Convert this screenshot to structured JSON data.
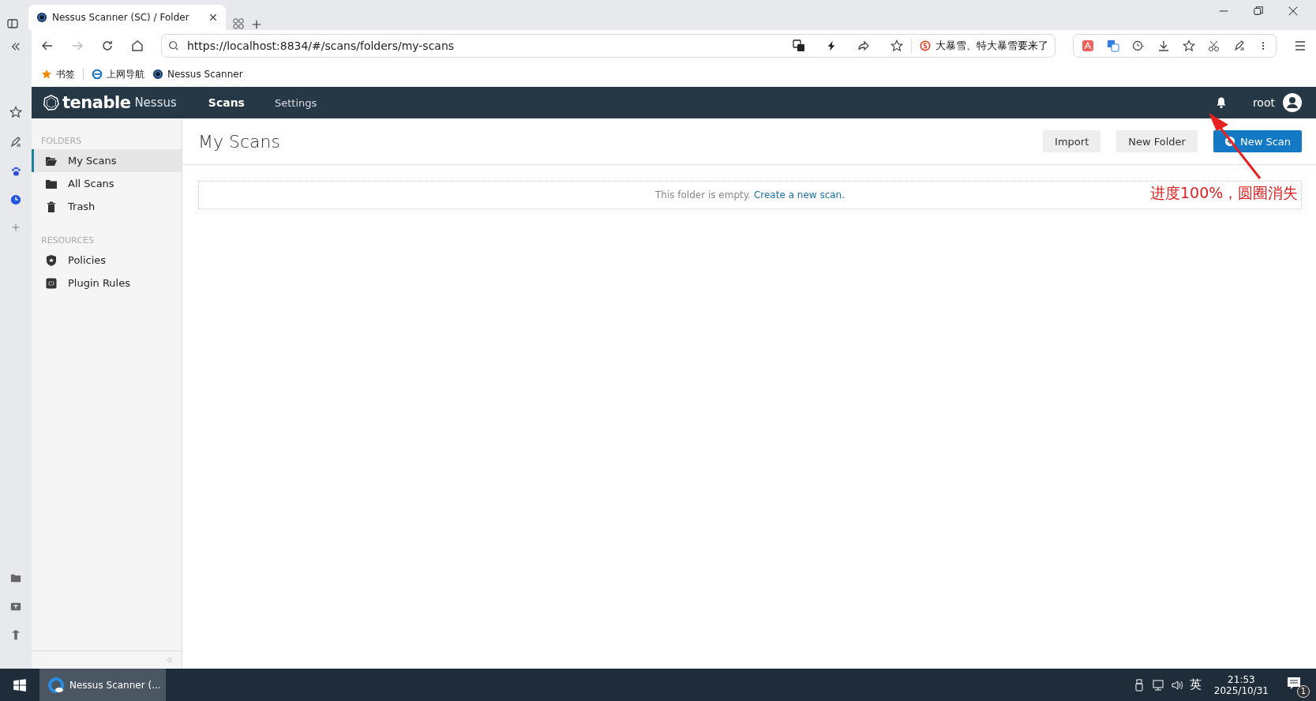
{
  "browser": {
    "tab": {
      "title": "Nessus Scanner (SC) / Folder",
      "selected": true
    },
    "address": "https://localhost:8834/#/scans/folders/my-scans",
    "search_suggestion": "大暴雪、特大暴雪要来了",
    "bookmarks": [
      {
        "label": "书签",
        "kind": "star"
      },
      {
        "label": "上网导航",
        "kind": "ie"
      },
      {
        "label": "Nessus Scanner",
        "kind": "nessus"
      }
    ]
  },
  "app": {
    "brand": "tenable",
    "product": "Nessus",
    "nav": [
      {
        "label": "Scans",
        "selected": true
      },
      {
        "label": "Settings",
        "selected": false
      }
    ],
    "user": "root",
    "sidebar": [
      {
        "heading": "FOLDERS",
        "items": [
          {
            "label": "My Scans",
            "kind": "folder-open",
            "selected": true
          },
          {
            "label": "All Scans",
            "kind": "folder",
            "selected": false
          },
          {
            "label": "Trash",
            "kind": "trash",
            "selected": false
          }
        ]
      },
      {
        "heading": "RESOURCES",
        "items": [
          {
            "label": "Policies",
            "kind": "shield",
            "selected": false
          },
          {
            "label": "Plugin Rules",
            "kind": "plugin",
            "selected": false
          }
        ]
      }
    ],
    "page_title": "My Scans",
    "buttons": [
      {
        "label": "Import",
        "kind": "secondary"
      },
      {
        "label": "New Folder",
        "kind": "secondary"
      },
      {
        "label": "New Scan",
        "kind": "primary"
      }
    ],
    "empty_message": "This folder is empty.",
    "empty_link": "Create a new scan."
  },
  "annotation": "进度100%，圆圈消失",
  "taskbar": {
    "app": "Nessus Scanner (...",
    "ime": "英",
    "time": "21:53",
    "date": "2025/10/31",
    "notifications": "1"
  }
}
